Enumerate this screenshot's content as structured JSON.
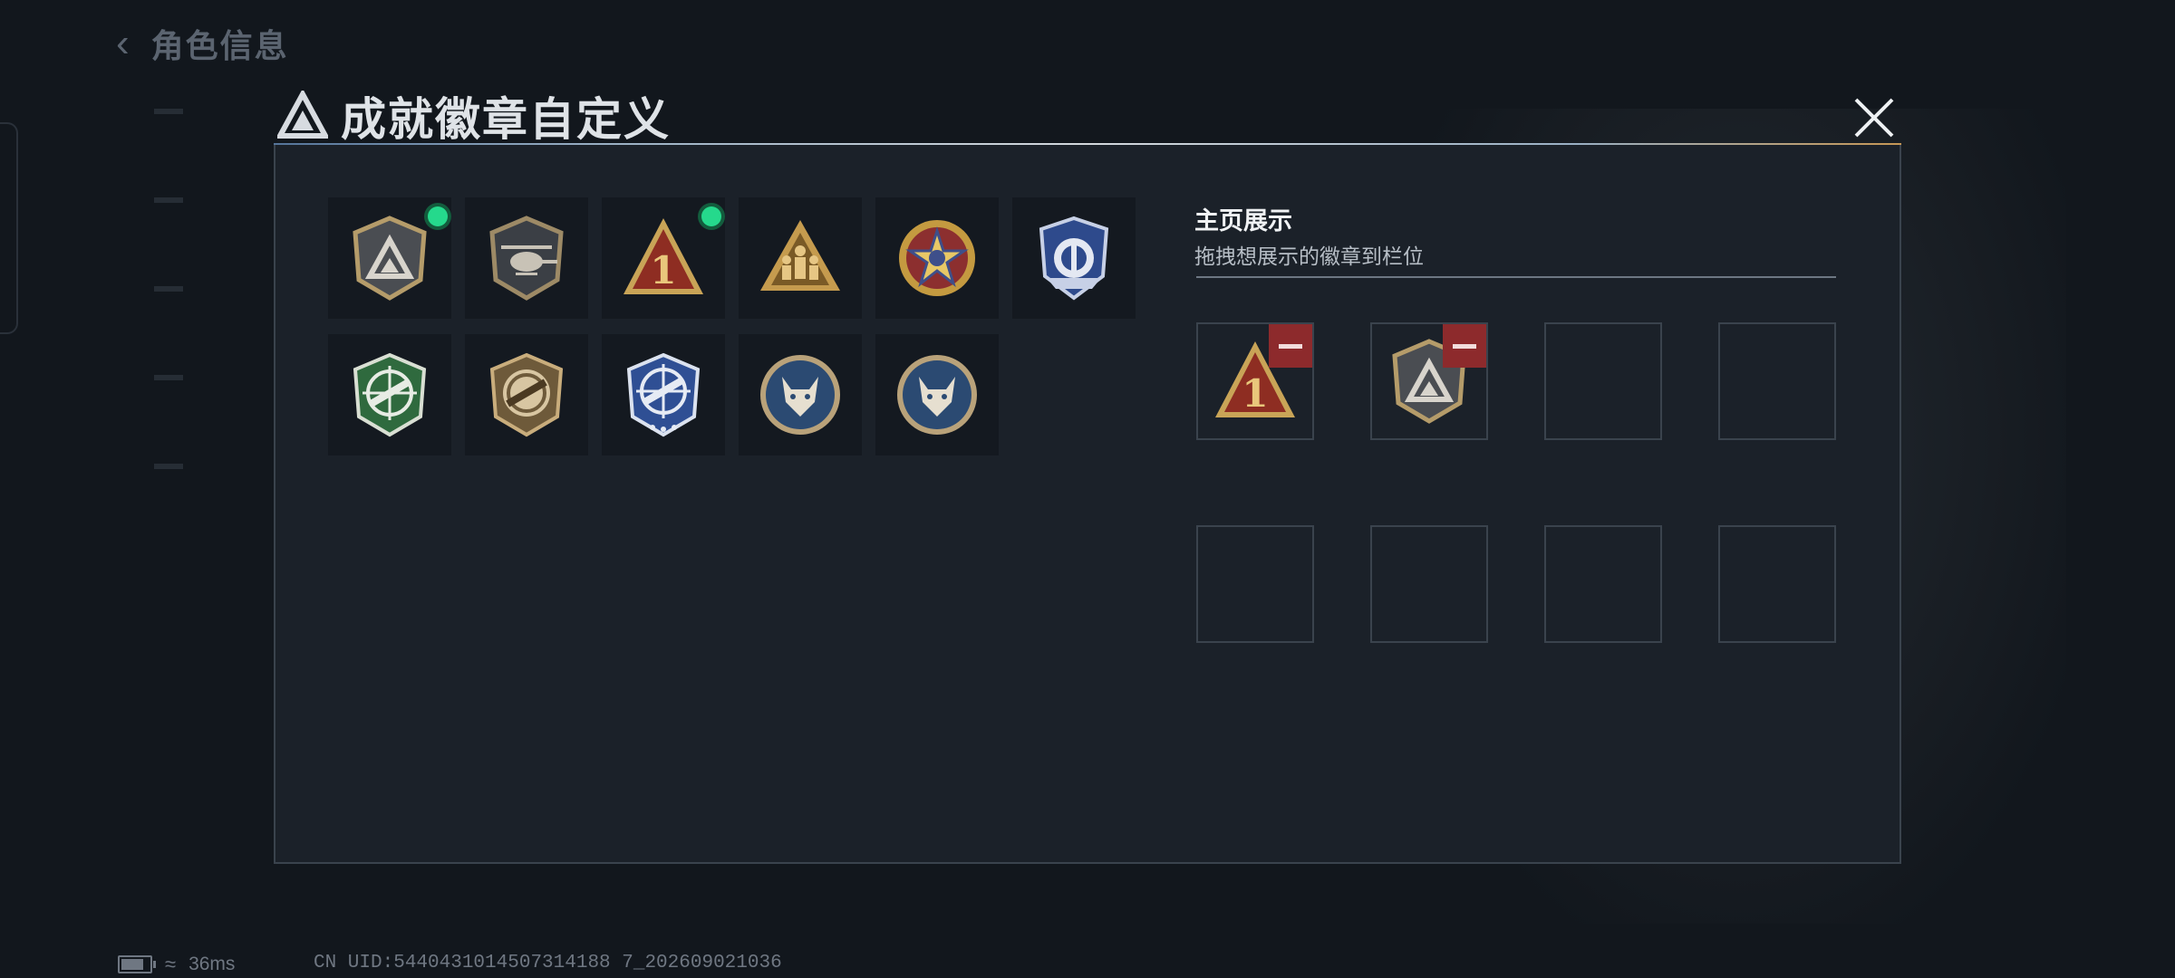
{
  "background": {
    "page_title": "角色信息"
  },
  "modal": {
    "title": "成就徽章自定义",
    "badges": [
      {
        "icon": "grey-shield-emblem-icon",
        "new": true
      },
      {
        "icon": "helicopter-shield-icon",
        "new": false
      },
      {
        "icon": "rank-one-triangle-icon",
        "new": true
      },
      {
        "icon": "soldiers-triangle-icon",
        "new": false
      },
      {
        "icon": "gold-star-medal-icon",
        "new": false
      },
      {
        "icon": "blue-police-shield-icon",
        "new": false
      },
      {
        "icon": "green-rifle-crosshair-icon",
        "new": false
      },
      {
        "icon": "bronze-rifle-crosshair-icon",
        "new": false
      },
      {
        "icon": "blue-rifle-crosshair-icon",
        "new": false
      },
      {
        "icon": "wolf-round-badge-icon",
        "new": false
      },
      {
        "icon": "wolf-round-badge-icon",
        "new": false
      }
    ],
    "showcase": {
      "title": "主页展示",
      "subtitle": "拖拽想展示的徽章到栏位",
      "slots": [
        {
          "icon": "rank-one-triangle-icon",
          "filled": true
        },
        {
          "icon": "grey-shield-emblem-icon",
          "filled": true
        },
        {
          "filled": false
        },
        {
          "filled": false
        },
        {
          "filled": false
        },
        {
          "filled": false
        },
        {
          "filled": false
        },
        {
          "filled": false
        }
      ]
    }
  },
  "status": {
    "latency": "36ms",
    "uid": "CN UID:5440431014507314188 7_202609021036"
  },
  "colors": {
    "new_dot": "#25d98c",
    "remove": "#8d2a2c",
    "modal_bg": "#1b2129"
  }
}
